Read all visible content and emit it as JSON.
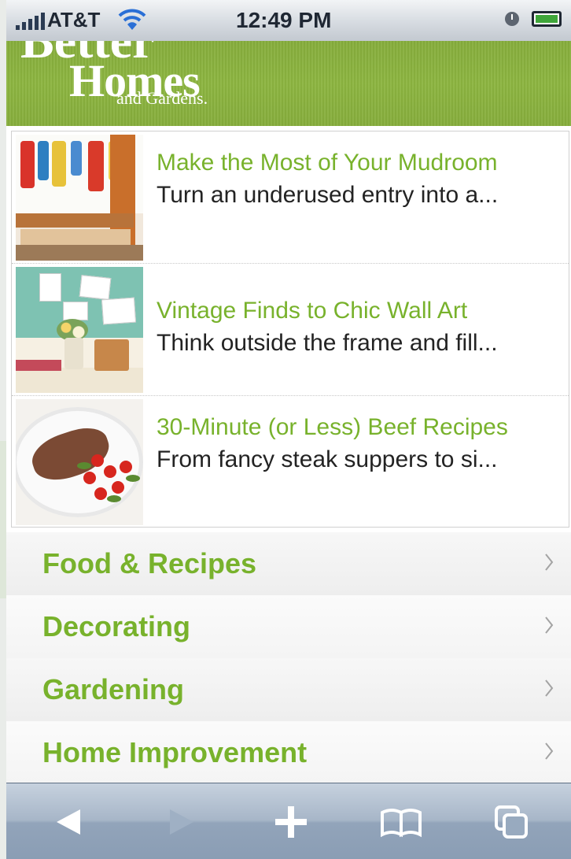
{
  "status_bar": {
    "carrier": "AT&T",
    "time": "12:49 PM"
  },
  "header": {
    "logo_line1": "Better",
    "logo_line2": "Homes",
    "logo_line3": "and Gardens."
  },
  "featured": [
    {
      "title": "Make the Most of Your Mudroom",
      "description": "Turn an underused entry into a..."
    },
    {
      "title": "Vintage Finds to Chic Wall Art",
      "description": "Think outside the frame and fill..."
    },
    {
      "title": "30-Minute (or Less) Beef Recipes",
      "description": "From fancy steak suppers to si..."
    }
  ],
  "menu": [
    {
      "label": "Food & Recipes"
    },
    {
      "label": "Decorating"
    },
    {
      "label": "Gardening"
    },
    {
      "label": "Home Improvement"
    }
  ],
  "toolbar": {
    "icons": [
      "back-arrow-icon",
      "forward-arrow-icon",
      "plus-icon",
      "bookmarks-icon",
      "pages-icon"
    ]
  },
  "colors": {
    "brand_green": "#8cb540",
    "link_green": "#78b22c",
    "toolbar_blue": "#a7b6c8"
  }
}
